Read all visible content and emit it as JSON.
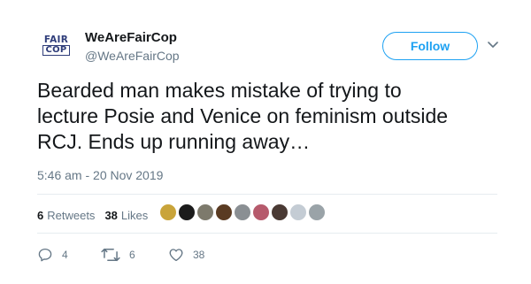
{
  "account": {
    "logo_text_top": "FAIR",
    "logo_text_bottom": "COP",
    "display_name": "WeAreFairCop",
    "handle": "@WeAreFairCop"
  },
  "follow_button": {
    "label": "Follow"
  },
  "tweet": {
    "text": "Bearded man makes mistake of trying to\nlecture Posie and Venice on feminism outside\nRCJ. Ends up running away…",
    "timestamp": "5:46 am - 20 Nov 2019"
  },
  "stats": {
    "retweets_count": "6",
    "retweets_label": "Retweets",
    "likes_count": "38",
    "likes_label": "Likes"
  },
  "liker_avatars": [
    {
      "color": "#c9a43a"
    },
    {
      "color": "#1b1b1b"
    },
    {
      "color": "#7d7a6c"
    },
    {
      "color": "#5a3b22"
    },
    {
      "color": "#8a8f93"
    },
    {
      "color": "#b65a6c"
    },
    {
      "color": "#4a3a34"
    },
    {
      "color": "#c4ccd4"
    },
    {
      "color": "#9aa3a8"
    }
  ],
  "actions": {
    "reply_count": "4",
    "retweet_count": "6",
    "like_count": "38"
  },
  "colors": {
    "accent": "#1da1f2",
    "secondary_text": "#657786",
    "brand_navy": "#2f3d7a"
  }
}
